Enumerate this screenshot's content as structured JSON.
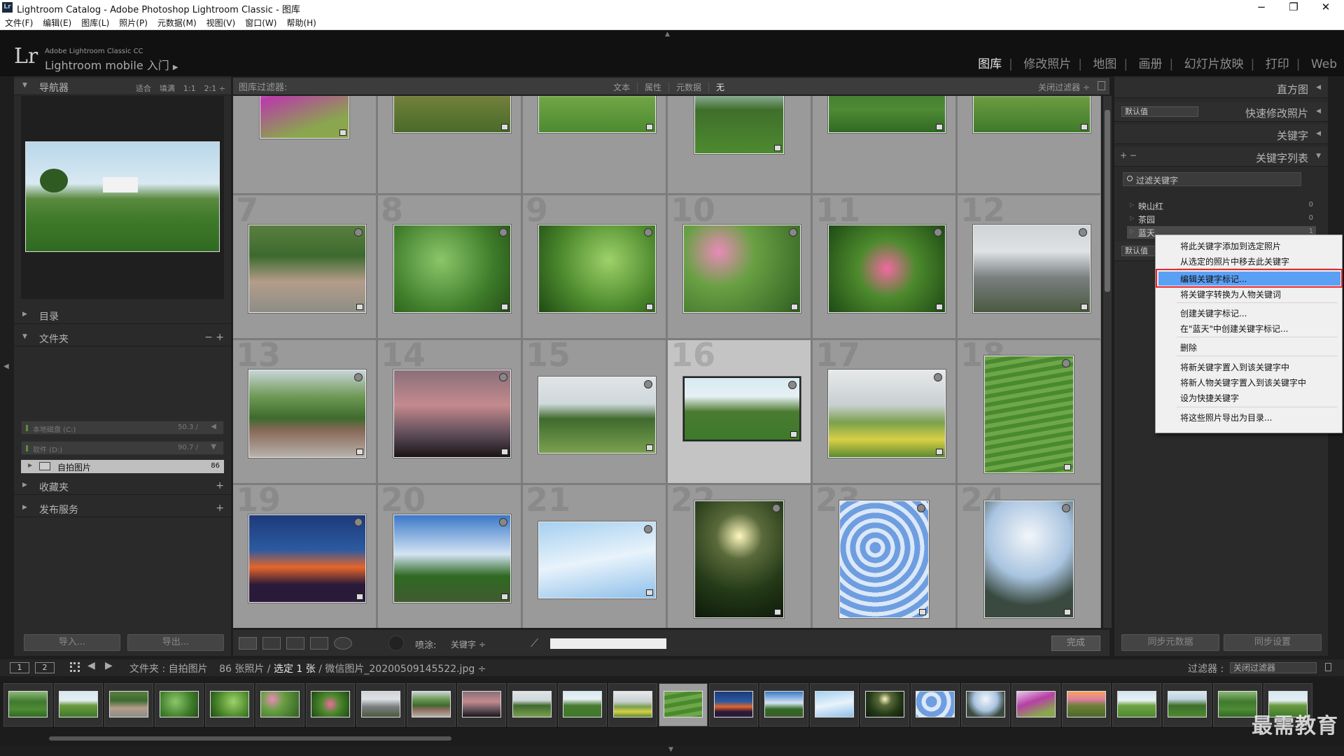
{
  "window": {
    "title": "Lightroom Catalog - Adobe Photoshop Lightroom Classic - 图库",
    "app_icon": "Lr",
    "minimize": "−",
    "maximize": "❐",
    "close": "✕"
  },
  "menu": [
    "文件(F)",
    "编辑(E)",
    "图库(L)",
    "照片(P)",
    "元数据(M)",
    "视图(V)",
    "窗口(W)",
    "帮助(H)"
  ],
  "identity": {
    "logo": "Lr",
    "product": "Adobe Lightroom Classic CC",
    "mobile": "Lightroom mobile 入门",
    "mobile_arrow": "▶"
  },
  "modules": {
    "items": [
      "图库",
      "修改照片",
      "地图",
      "画册",
      "幻灯片放映",
      "打印",
      "Web"
    ],
    "active": "图库",
    "separator": "|"
  },
  "left_panel": {
    "navigator": {
      "title": "导航器",
      "options": [
        "适合",
        "填满",
        "1:1",
        "2:1 ÷"
      ]
    },
    "catalog": {
      "title": "目录"
    },
    "folders": {
      "title": "文件夹",
      "actions": "−  +",
      "volumes": [
        {
          "name": "本地磁盘 (C:)",
          "value": "50.3 /"
        },
        {
          "name": "软件 (D:)",
          "value": "90.7 /"
        }
      ],
      "folder": {
        "name": "自拍图片",
        "count": "86"
      }
    },
    "collections": {
      "title": "收藏夹",
      "action": "+"
    },
    "publish": {
      "title": "发布服务",
      "action": "+"
    },
    "buttons": {
      "import": "导入...",
      "export": "导出..."
    }
  },
  "filter_bar": {
    "label": "图库过滤器:",
    "tabs": [
      "文本",
      "属性",
      "元数据",
      "无"
    ],
    "active_tab": "无",
    "close": "关闭过滤器 ÷"
  },
  "grid": {
    "cells": [
      {
        "num": "",
        "sel": false
      },
      {
        "num": "",
        "sel": false
      },
      {
        "num": "",
        "sel": false
      },
      {
        "num": "",
        "sel": false
      },
      {
        "num": "",
        "sel": false
      },
      {
        "num": "",
        "sel": false
      },
      {
        "num": "7",
        "sel": false
      },
      {
        "num": "8",
        "sel": false
      },
      {
        "num": "9",
        "sel": false
      },
      {
        "num": "10",
        "sel": false
      },
      {
        "num": "11",
        "sel": false
      },
      {
        "num": "12",
        "sel": false
      },
      {
        "num": "13",
        "sel": false
      },
      {
        "num": "14",
        "sel": false
      },
      {
        "num": "15",
        "sel": false
      },
      {
        "num": "16",
        "sel": true
      },
      {
        "num": "17",
        "sel": false
      },
      {
        "num": "18",
        "sel": false
      },
      {
        "num": "19",
        "sel": false
      },
      {
        "num": "20",
        "sel": false
      },
      {
        "num": "21",
        "sel": false
      },
      {
        "num": "22",
        "sel": false
      },
      {
        "num": "23",
        "sel": false
      },
      {
        "num": "24",
        "sel": false
      }
    ]
  },
  "toolbar": {
    "spray_label": "喷涂:",
    "spray_target": "关键字 ÷",
    "done": "完成"
  },
  "right_panel": {
    "histogram": "直方图",
    "quick_develop": {
      "preset": "默认值",
      "title": "快速修改照片"
    },
    "keywording": "关键字",
    "keyword_list": {
      "title": "关键字列表",
      "add_remove": "+ −",
      "search_placeholder": "过滤关键字"
    },
    "keywords": [
      {
        "name": "映山红",
        "count": "0"
      },
      {
        "name": "茶园",
        "count": "0"
      },
      {
        "name": "蓝天",
        "count": "1"
      }
    ],
    "metadata_preset": "默认值",
    "buttons": {
      "sync_metadata": "同步元数据",
      "sync_settings": "同步设置"
    }
  },
  "context_menu": {
    "items": [
      "将此关键字添加到选定照片",
      "从选定的照片中移去此关键字",
      "编辑关键字标记...",
      "将关键字转换为人物关键词",
      "创建关键字标记...",
      "在\"蓝天\"中创建关键字标记...",
      "删除",
      "将新关键字置入到该关键字中",
      "将新人物关键字置入到该关键字中",
      "设为快捷关键字",
      "将这些照片导出为目录..."
    ],
    "highlighted_index": 2
  },
  "filmstrip_bar": {
    "page1": "1",
    "page2": "2",
    "path": "文件夹 : 自拍图片",
    "count": "86 张照片 /",
    "selection": "选定 1 张",
    "file": "/ 微信图片_20200509145522.jpg ÷",
    "filter_label": "过滤器 :",
    "filter_value": "关闭过滤器"
  },
  "watermark": "最需教育",
  "colors": {
    "accent_highlight": "#5aa0f5",
    "annotation_red": "#e8262d",
    "background": "#1e1e1e"
  }
}
